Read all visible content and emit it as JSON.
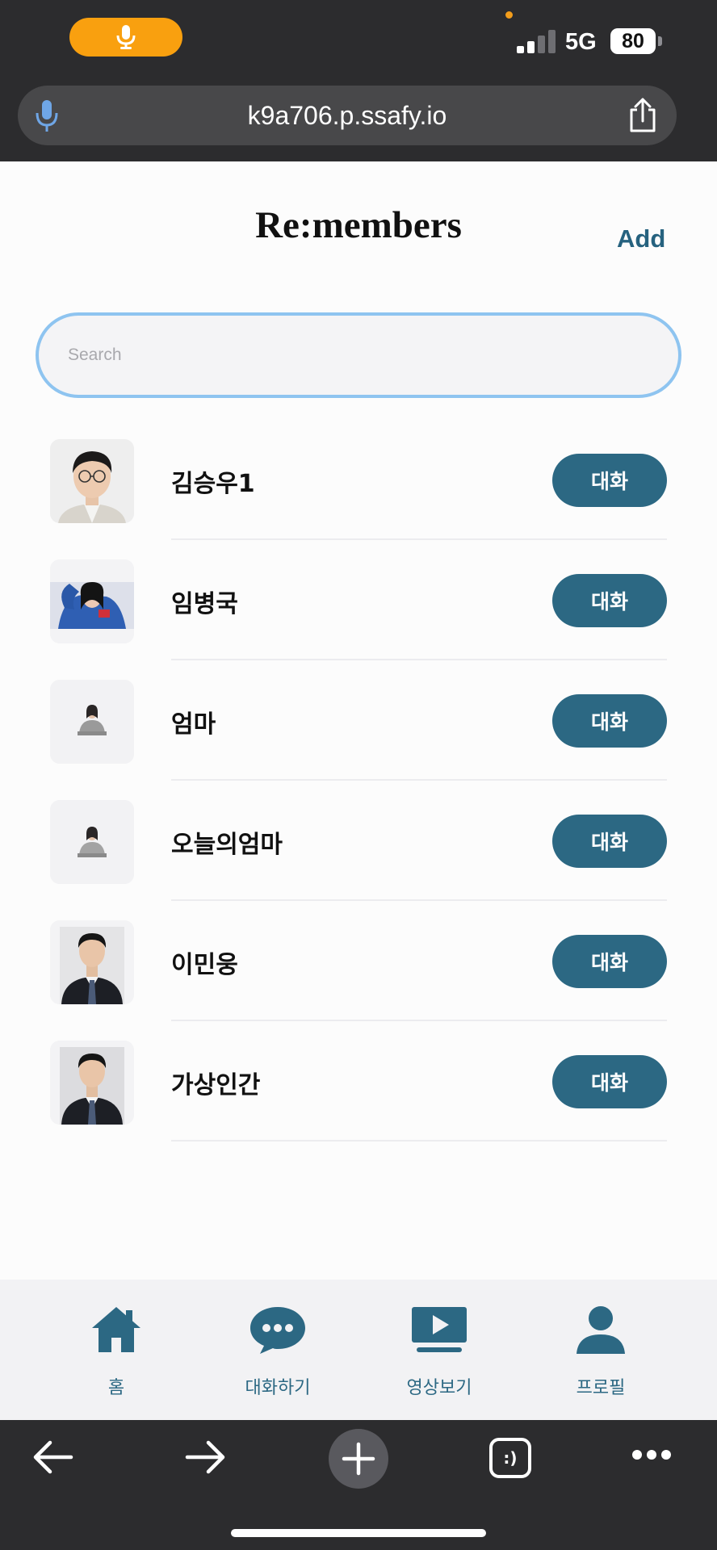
{
  "status_bar": {
    "network": "5G",
    "battery": "80",
    "signal_bars": 2,
    "recording_color": "#f9a00f"
  },
  "browser": {
    "url": "k9a706.p.ssafy.io",
    "tabs_glyph": ":)"
  },
  "header": {
    "title": "Re:members",
    "add_label": "Add"
  },
  "search": {
    "placeholder": "Search",
    "value": ""
  },
  "members": [
    {
      "name": "김승우1",
      "button": "대화",
      "avatar": "man-glasses"
    },
    {
      "name": "임병국",
      "button": "대화",
      "avatar": "person-blue"
    },
    {
      "name": "엄마",
      "button": "대화",
      "avatar": "woman-small"
    },
    {
      "name": "오늘의엄마",
      "button": "대화",
      "avatar": "woman-small"
    },
    {
      "name": "이민웅",
      "button": "대화",
      "avatar": "man-suit"
    },
    {
      "name": "가상인간",
      "button": "대화",
      "avatar": "man-suit"
    }
  ],
  "nav": [
    {
      "label": "홈",
      "icon": "home-icon"
    },
    {
      "label": "대화하기",
      "icon": "chat-icon"
    },
    {
      "label": "영상보기",
      "icon": "video-icon"
    },
    {
      "label": "프로필",
      "icon": "profile-icon"
    }
  ],
  "colors": {
    "accent": "#2c6883",
    "title": "#26627f",
    "search_border": "#8ec4f0"
  }
}
